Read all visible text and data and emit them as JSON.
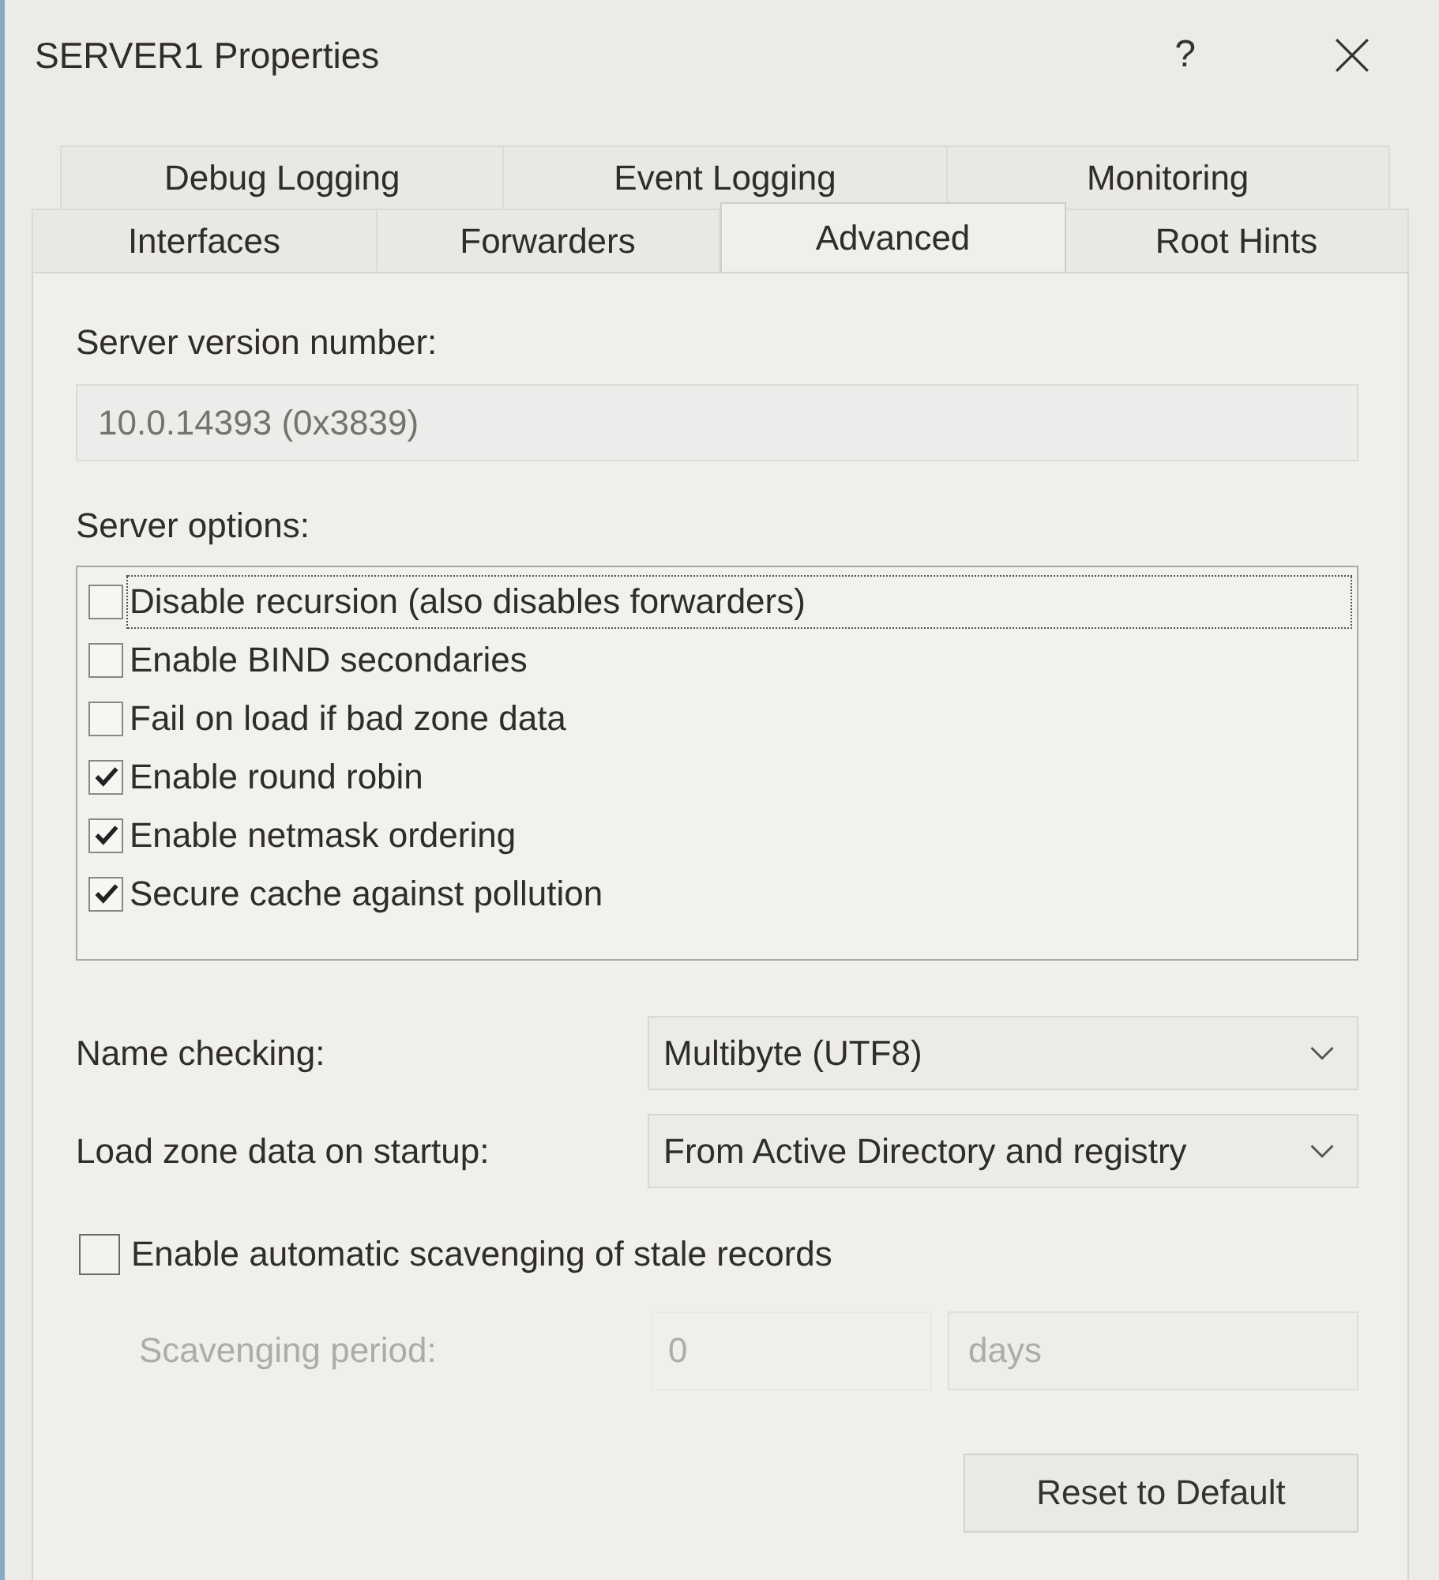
{
  "window": {
    "title": "SERVER1 Properties",
    "help_button": "?"
  },
  "tabs": {
    "rows": [
      [
        {
          "label": "Debug Logging",
          "selected": false
        },
        {
          "label": "Event Logging",
          "selected": false
        },
        {
          "label": "Monitoring",
          "selected": false
        }
      ],
      [
        {
          "label": "Interfaces",
          "selected": false
        },
        {
          "label": "Forwarders",
          "selected": false
        },
        {
          "label": "Advanced",
          "selected": true
        },
        {
          "label": "Root Hints",
          "selected": false
        }
      ]
    ]
  },
  "version": {
    "label": "Server version number:",
    "value": "10.0.14393 (0x3839)",
    "disabled": true
  },
  "server_options": {
    "label": "Server options:",
    "items": [
      {
        "label": "Disable recursion (also disables forwarders)",
        "checked": false,
        "focused": true
      },
      {
        "label": "Enable BIND secondaries",
        "checked": false,
        "focused": false
      },
      {
        "label": "Fail on load if bad zone data",
        "checked": false,
        "focused": false
      },
      {
        "label": "Enable round robin",
        "checked": true,
        "focused": false
      },
      {
        "label": "Enable netmask ordering",
        "checked": true,
        "focused": false
      },
      {
        "label": "Secure cache against pollution",
        "checked": true,
        "focused": false
      }
    ]
  },
  "dropdowns": [
    {
      "label": "Name checking:",
      "value": "Multibyte (UTF8)"
    },
    {
      "label": "Load zone data on startup:",
      "value": "From Active Directory and registry"
    }
  ],
  "scavenging": {
    "label": "Enable automatic scavenging of stale records",
    "checked": false
  },
  "scavenging_period": {
    "label": "Scavenging period:",
    "value": "0",
    "unit": "days",
    "disabled": true
  },
  "buttons": [
    {
      "label": "Reset to Default"
    }
  ]
}
